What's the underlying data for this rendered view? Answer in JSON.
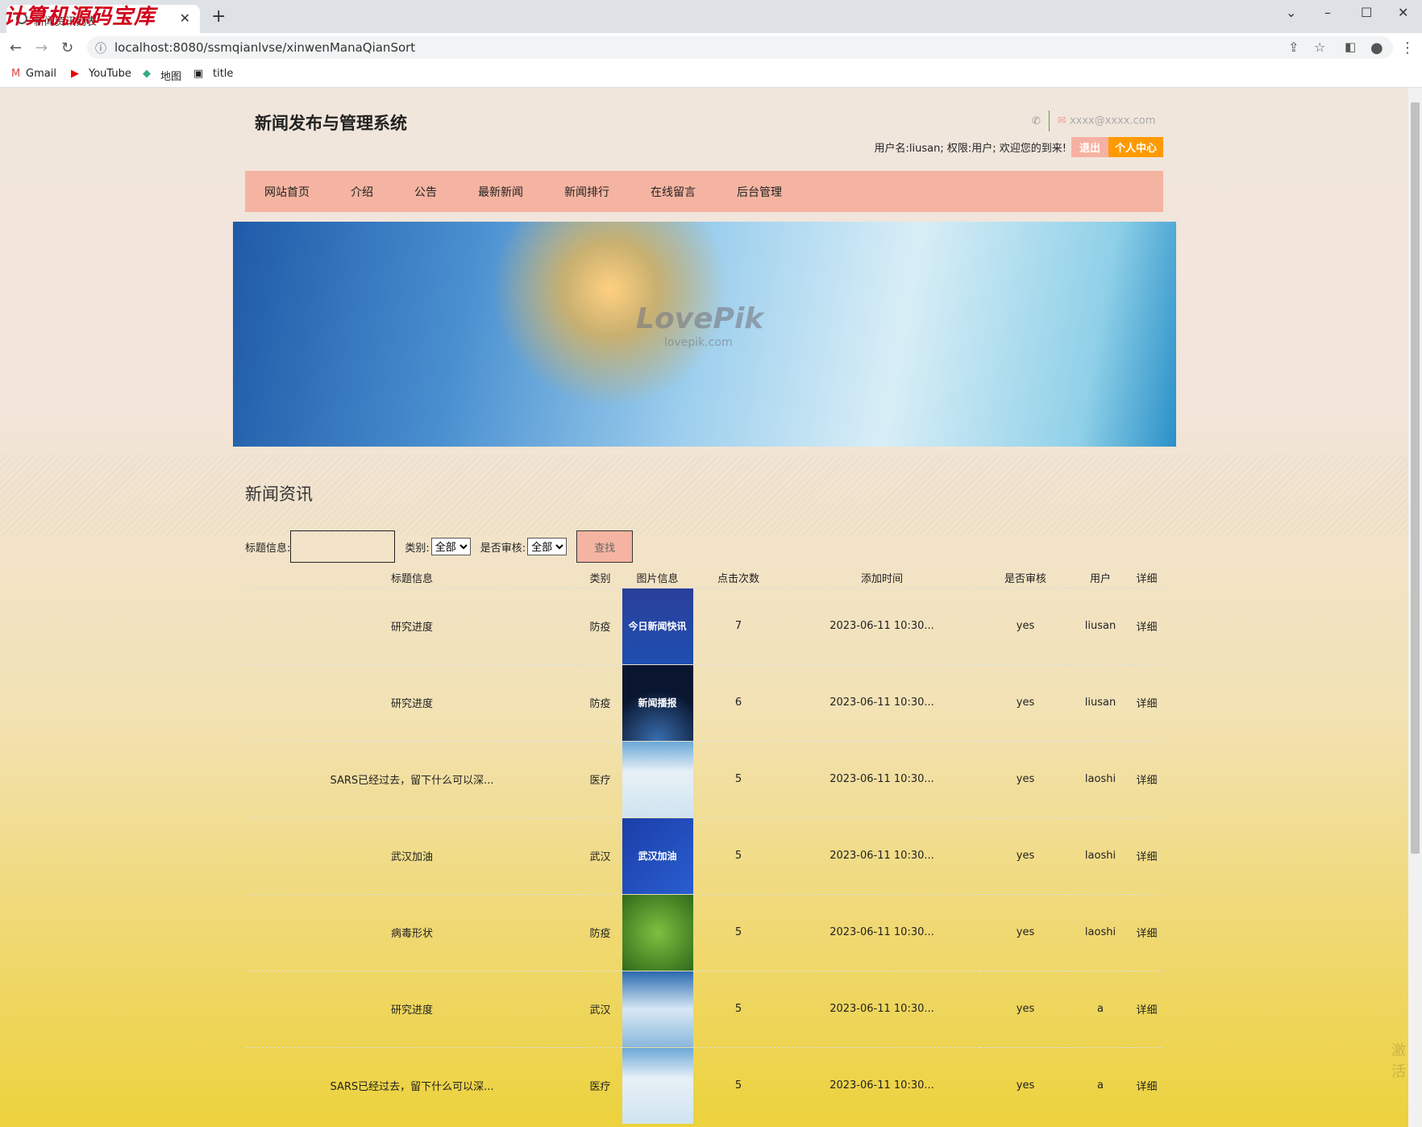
{
  "browser": {
    "watermark": "计算机源码宝库",
    "tab_title": "新闻资讯列表",
    "url": "localhost:8080/ssmqianlvse/xinwenManaQianSort",
    "bookmarks": [
      "Gmail",
      "YouTube",
      "地图",
      "title"
    ]
  },
  "header": {
    "site_title": "新闻发布与管理系统",
    "email": "xxxx@xxxx.com",
    "user_info": "用户名:liusan; 权限:用户; 欢迎您的到来!",
    "logout": "退出",
    "profile": "个人中心"
  },
  "nav": [
    "网站首页",
    "介绍",
    "公告",
    "最新新闻",
    "新闻排行",
    "在线留言",
    "后台管理"
  ],
  "banner": {
    "watermark": "LovePik",
    "watermark_sub": "lovepik.com"
  },
  "section_title": "新闻资讯",
  "search": {
    "title_label": "标题信息:",
    "title_value": "",
    "category_label": "类别:",
    "category_value": "全部",
    "audit_label": "是否审核:",
    "audit_value": "全部",
    "button": "查找"
  },
  "table": {
    "headers": [
      "标题信息",
      "类别",
      "图片信息",
      "点击次数",
      "添加时间",
      "是否审核",
      "用户",
      "详细"
    ],
    "rows": [
      {
        "title": "研究进度",
        "category": "防疫",
        "image": "今日新闻快讯",
        "clicks": "7",
        "time": "2023-06-11 10:30...",
        "audit": "yes",
        "user": "liusan",
        "detail": "详细"
      },
      {
        "title": "研究进度",
        "category": "防疫",
        "image": "新闻播报",
        "clicks": "6",
        "time": "2023-06-11 10:30...",
        "audit": "yes",
        "user": "liusan",
        "detail": "详细"
      },
      {
        "title": "SARS已经过去，留下什么可以深...",
        "category": "医疗",
        "image": "",
        "clicks": "5",
        "time": "2023-06-11 10:30...",
        "audit": "yes",
        "user": "laoshi",
        "detail": "详细"
      },
      {
        "title": "武汉加油",
        "category": "武汉",
        "image": "武汉加油",
        "clicks": "5",
        "time": "2023-06-11 10:30...",
        "audit": "yes",
        "user": "laoshi",
        "detail": "详细"
      },
      {
        "title": "病毒形状",
        "category": "防疫",
        "image": "",
        "clicks": "5",
        "time": "2023-06-11 10:30...",
        "audit": "yes",
        "user": "laoshi",
        "detail": "详细"
      },
      {
        "title": "研究进度",
        "category": "武汉",
        "image": "",
        "clicks": "5",
        "time": "2023-06-11 10:30...",
        "audit": "yes",
        "user": "a",
        "detail": "详细"
      },
      {
        "title": "SARS已经过去，留下什么可以深...",
        "category": "医疗",
        "image": "",
        "clicks": "5",
        "time": "2023-06-11 10:30...",
        "audit": "yes",
        "user": "a",
        "detail": "详细"
      }
    ]
  },
  "colors": {
    "nav_bg": "#f5b4a1",
    "logout_bg": "#f6b1a2",
    "profile_bg": "#ff9a00"
  }
}
